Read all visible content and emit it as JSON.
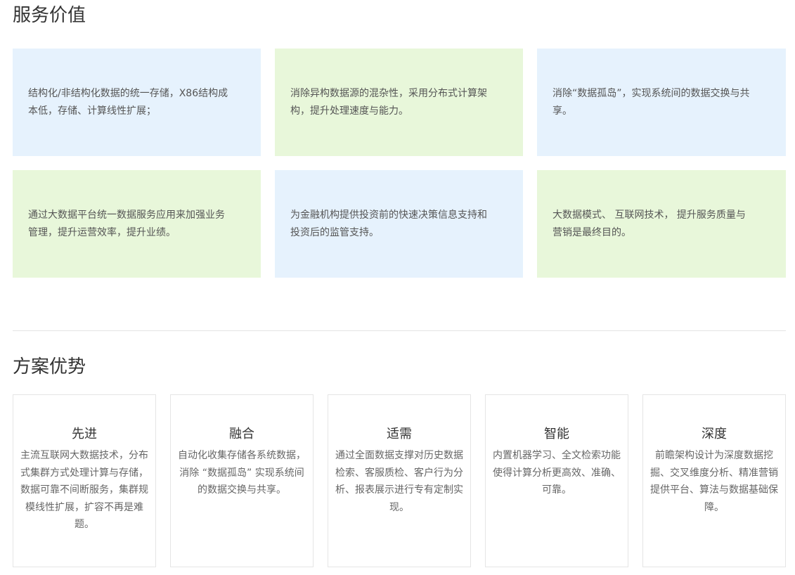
{
  "sections": {
    "value": {
      "title": "服务价值",
      "cards": [
        {
          "text": "结构化/非结构化数据的统一存储，X86结构成本低，存储、计算线性扩展；",
          "color": "#e6f2fd"
        },
        {
          "text": "消除异构数据源的混杂性，采用分布式计算架构，提升处理速度与能力。",
          "color": "#e8f7da"
        },
        {
          "text": "消除“数据孤岛”，实现系统间的数据交换与共享。",
          "color": "#e6f2fd"
        },
        {
          "text": "通过大数据平台统一数据服务应用来加强业务管理，提升运营效率，提升业绩。",
          "color": "#e8f7da"
        },
        {
          "text": "为金融机构提供投资前的快速决策信息支持和投资后的监管支持。",
          "color": "#e6f2fd"
        },
        {
          "text": "大数据模式、 互联网技术， 提升服务质量与营销是最终目的。",
          "color": "#e8f7da"
        }
      ]
    },
    "advantage": {
      "title": "方案优势",
      "cards": [
        {
          "title": "先进",
          "desc": "主流互联网大数据技术，分布式集群方式处理计算与存储，数据可靠不间断服务，集群规模线性扩展，扩容不再是难题。"
        },
        {
          "title": "融合",
          "desc": "自动化收集存储各系统数据，消除 “数据孤岛” 实现系统间的数据交换与共享。"
        },
        {
          "title": "适需",
          "desc": "通过全面数据支撑对历史数据检索、客服质检、客户行为分析、报表展示进行专有定制实现。"
        },
        {
          "title": "智能",
          "desc": "内置机器学习、全文检索功能使得计算分析更高效、准确、可靠。"
        },
        {
          "title": "深度",
          "desc": "前瞻架构设计为深度数据挖掘、交叉维度分析、精准营销提供平台、算法与数据基础保障。"
        }
      ]
    }
  }
}
